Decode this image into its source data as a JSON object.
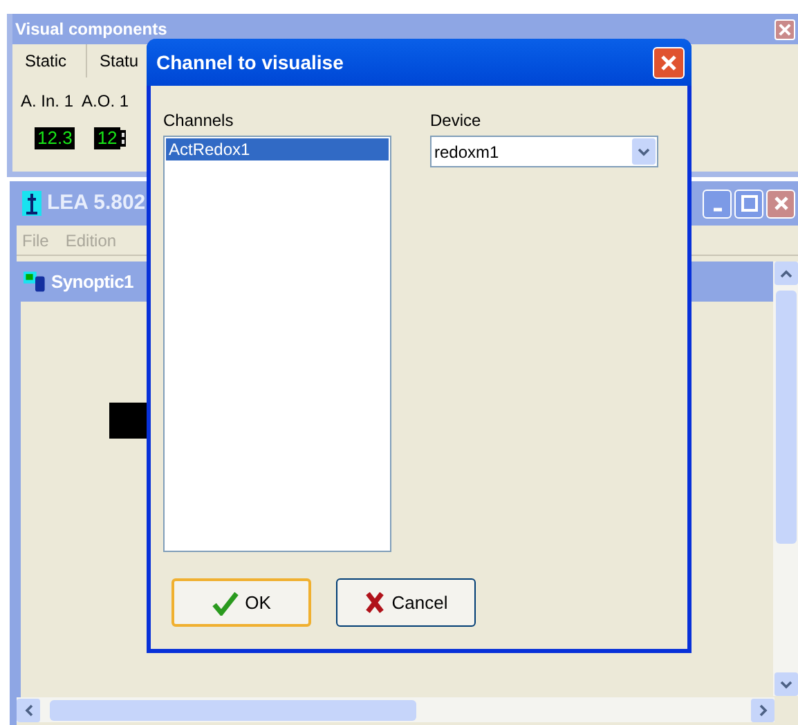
{
  "visual_components": {
    "title": "Visual components",
    "tabs": [
      {
        "label": "Static",
        "selected": true
      },
      {
        "label": "Statu",
        "selected": false
      }
    ],
    "labels": [
      "A. In. 1",
      "A.O. 1"
    ],
    "displays": [
      {
        "value": "12.3",
        "kind": "plain"
      },
      {
        "value": "12",
        "kind": "spin"
      }
    ]
  },
  "main_window": {
    "title": "LEA 5.802",
    "menu": [
      "File",
      "Edition"
    ],
    "child_title": "Synoptic1"
  },
  "dialog": {
    "title": "Channel to visualise",
    "channels_label": "Channels",
    "channels": [
      {
        "label": "ActRedox1",
        "selected": true
      }
    ],
    "device_label": "Device",
    "device": "redoxm1",
    "buttons": [
      {
        "label": "OK",
        "kind": "ok"
      },
      {
        "label": "Cancel",
        "kind": "cancel"
      }
    ]
  }
}
